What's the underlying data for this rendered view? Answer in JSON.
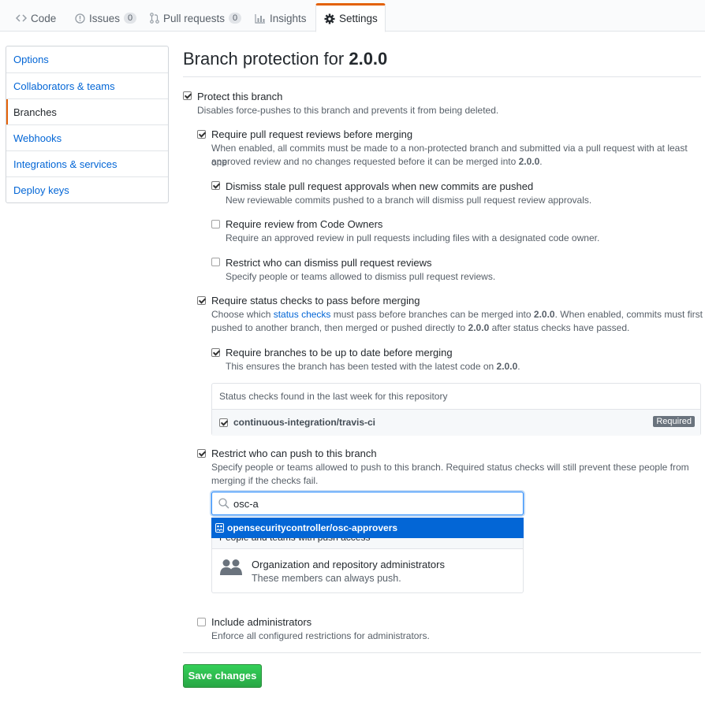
{
  "tabs": [
    {
      "label": "Code",
      "icon": "code-icon"
    },
    {
      "label": "Issues",
      "icon": "issue-icon",
      "count": "0"
    },
    {
      "label": "Pull requests",
      "icon": "pull-request-icon",
      "count": "0"
    },
    {
      "label": "Insights",
      "icon": "graph-icon"
    },
    {
      "label": "Settings",
      "icon": "gear-icon"
    }
  ],
  "sidebar": {
    "items": [
      {
        "label": "Options"
      },
      {
        "label": "Collaborators & teams"
      },
      {
        "label": "Branches"
      },
      {
        "label": "Webhooks"
      },
      {
        "label": "Integrations & services"
      },
      {
        "label": "Deploy keys"
      }
    ]
  },
  "page": {
    "title_prefix": "Branch protection for ",
    "branch": "2.0.0"
  },
  "options": {
    "protect": {
      "label": "Protect this branch",
      "note": "Disables force-pushes to this branch and prevents it from being deleted.",
      "checked": true
    },
    "reviews": {
      "label": "Require pull request reviews before merging",
      "note_1": "When enabled, all commits must be made to a non-protected branch and submitted via a pull request with at least one",
      "note_2a": "approved review and no changes requested before it can be merged into ",
      "note_2b": "2.0.0",
      "note_2c": ".",
      "checked": true
    },
    "dismiss_stale": {
      "label": "Dismiss stale pull request approvals when new commits are pushed",
      "note": "New reviewable commits pushed to a branch will dismiss pull request review approvals.",
      "checked": true
    },
    "code_owners": {
      "label": "Require review from Code Owners",
      "note": "Require an approved review in pull requests including files with a designated code owner.",
      "checked": false
    },
    "restrict_dismiss": {
      "label": "Restrict who can dismiss pull request reviews",
      "note": "Specify people or teams allowed to dismiss pull request reviews.",
      "checked": false
    },
    "status_checks": {
      "label": "Require status checks to pass before merging",
      "note_1a": "Choose which ",
      "note_1_link": "status checks",
      "note_1b": " must pass before branches can be merged into ",
      "note_1c": "2.0.0",
      "note_1d": ". When enabled, commits must first be",
      "note_2a": "pushed to another branch, then merged or pushed directly to ",
      "note_2b": "2.0.0",
      "note_2c": " after status checks have passed.",
      "checked": true
    },
    "up_to_date": {
      "label": "Require branches to be up to date before merging",
      "note_a": "This ensures the branch has been tested with the latest code on ",
      "note_b": "2.0.0",
      "note_c": ".",
      "checked": true
    },
    "restrict_push": {
      "label": "Restrict who can push to this branch",
      "note_1": "Specify people or teams allowed to push to this branch. Required status checks will still prevent these people from",
      "note_2": "merging if the checks fail.",
      "checked": true
    },
    "include_admins": {
      "label": "Include administrators",
      "note": "Enforce all configured restrictions for administrators.",
      "checked": false
    }
  },
  "status_box": {
    "header": "Status checks found in the last week for this repository",
    "check_name": "continuous-integration/travis-ci",
    "badge": "Required"
  },
  "push_search": {
    "value": "osc-a",
    "suggestion": "opensecuritycontroller/osc-approvers",
    "list_header": "People and teams with push access",
    "admins_title": "Organization and repository administrators",
    "admins_note": "These members can always push."
  },
  "save_button": "Save changes",
  "colors": {
    "accent_orange": "#e36209",
    "link_blue": "#0366d6",
    "save_green": "#28a745"
  }
}
